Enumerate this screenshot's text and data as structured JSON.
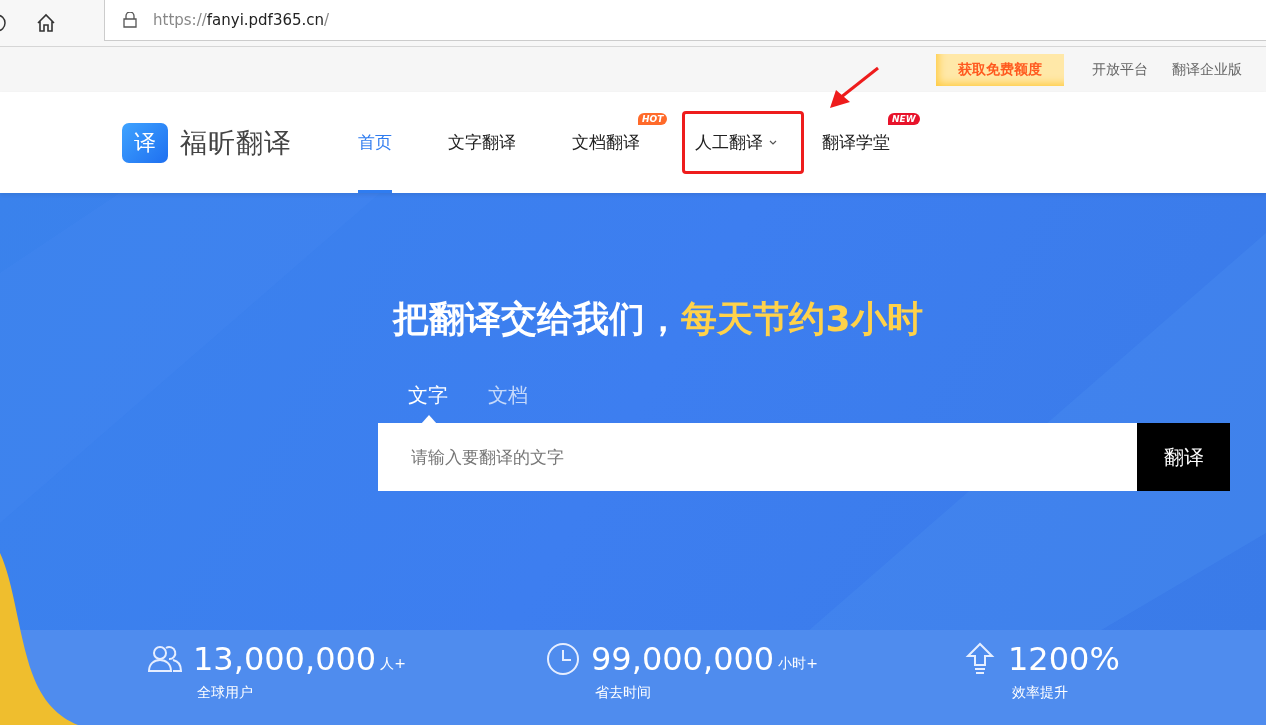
{
  "browser": {
    "url_scheme": "https://",
    "url_host": "fanyi.pdf365.cn",
    "url_path": "/"
  },
  "topbar": {
    "promo": "获取免费额度",
    "links": [
      "开放平台",
      "翻译企业版"
    ]
  },
  "logo": {
    "mark": "译",
    "name": "福昕翻译"
  },
  "nav": [
    {
      "label": "首页",
      "selected": true
    },
    {
      "label": "文字翻译",
      "selected": false
    },
    {
      "label": "文档翻译",
      "selected": false,
      "badge": {
        "text": "HOT",
        "color": "#ff6a2a"
      }
    },
    {
      "label": "人工翻译",
      "selected": false,
      "dropdown": true,
      "highlighted": true
    },
    {
      "label": "翻译学堂",
      "selected": false,
      "badge": {
        "text": "NEW",
        "color": "#e8132b"
      }
    }
  ],
  "hero": {
    "title": "把翻译交给我们，",
    "title_accent": "每天节约3小时"
  },
  "mode_tabs": [
    {
      "label": "文字",
      "selected": true
    },
    {
      "label": "文档",
      "selected": false
    }
  ],
  "input": {
    "placeholder": "请输入要翻译的文字"
  },
  "translate_button": "翻译",
  "stats": [
    {
      "kind": "users",
      "value": "13,000,000",
      "unit": "人+",
      "caption": "全球用户"
    },
    {
      "kind": "clock",
      "value": "99,000,000",
      "unit": "小时+",
      "caption": "省去时间"
    },
    {
      "kind": "boost",
      "value": "1200%",
      "caption": "效率提升"
    }
  ]
}
